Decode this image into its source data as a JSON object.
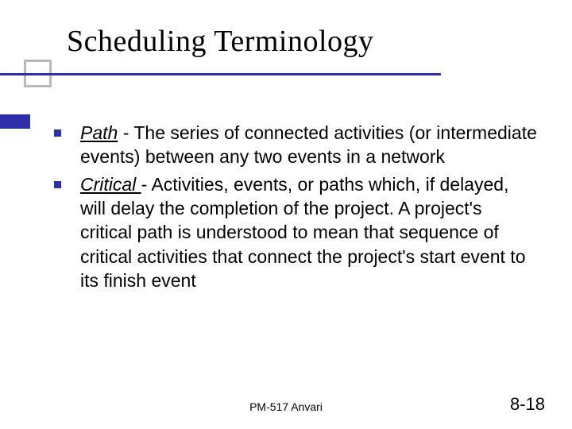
{
  "title": "Scheduling Terminology",
  "items": [
    {
      "term": "Path",
      "sep": " - ",
      "def": "The series of connected activities (or intermediate events) between any two events in a network"
    },
    {
      "term": "Critical ",
      "sep": "- ",
      "def": "Activities, events, or paths which, if delayed, will delay the completion of the project. A project's critical path is understood to mean that sequence of critical activities that connect the project's start event to its finish event"
    }
  ],
  "footer": {
    "center": "PM-517   Anvari",
    "right": "8-18"
  }
}
